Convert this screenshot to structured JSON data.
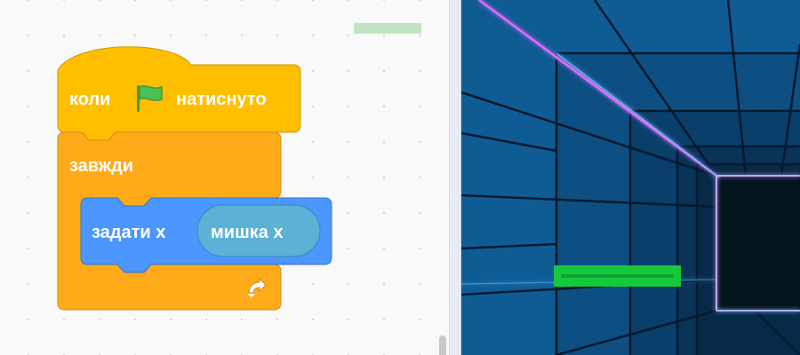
{
  "code_area": {
    "hat_block": {
      "prefix": "коли",
      "flag_icon": "green-flag-icon",
      "suffix": "натиснуто"
    },
    "forever_block": {
      "label": "завжди",
      "loop_icon": "loop-arrow-icon"
    },
    "motion_block": {
      "label": "задати х",
      "reporter": "мишка х"
    }
  },
  "colors": {
    "events": "#ffbf00",
    "control": "#ffab19",
    "motion": "#4c97ff",
    "sensing": "#5cb1d6",
    "paddle": "#16c93c",
    "stage_blue": "#0f5c95",
    "neon_pink": "#e36bff"
  },
  "stage": {
    "sprite": "paddle-sprite"
  }
}
